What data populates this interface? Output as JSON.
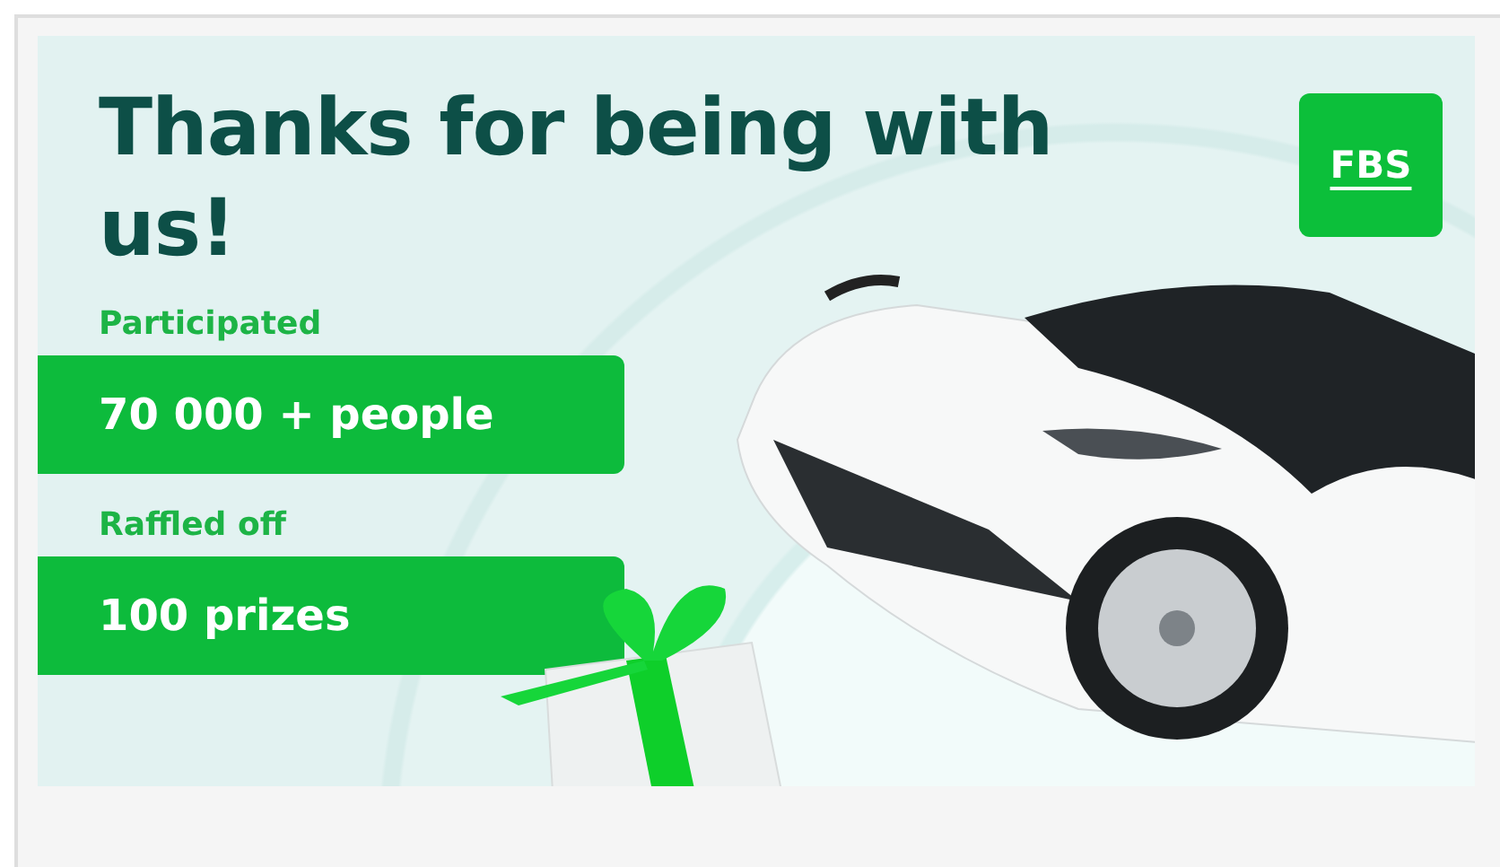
{
  "headline": "Thanks for being with us!",
  "logo": {
    "text": "FBS"
  },
  "stats": [
    {
      "label": "Participated",
      "value": "70 000 + people"
    },
    {
      "label": "Raffled off",
      "value": "100 prizes"
    }
  ]
}
